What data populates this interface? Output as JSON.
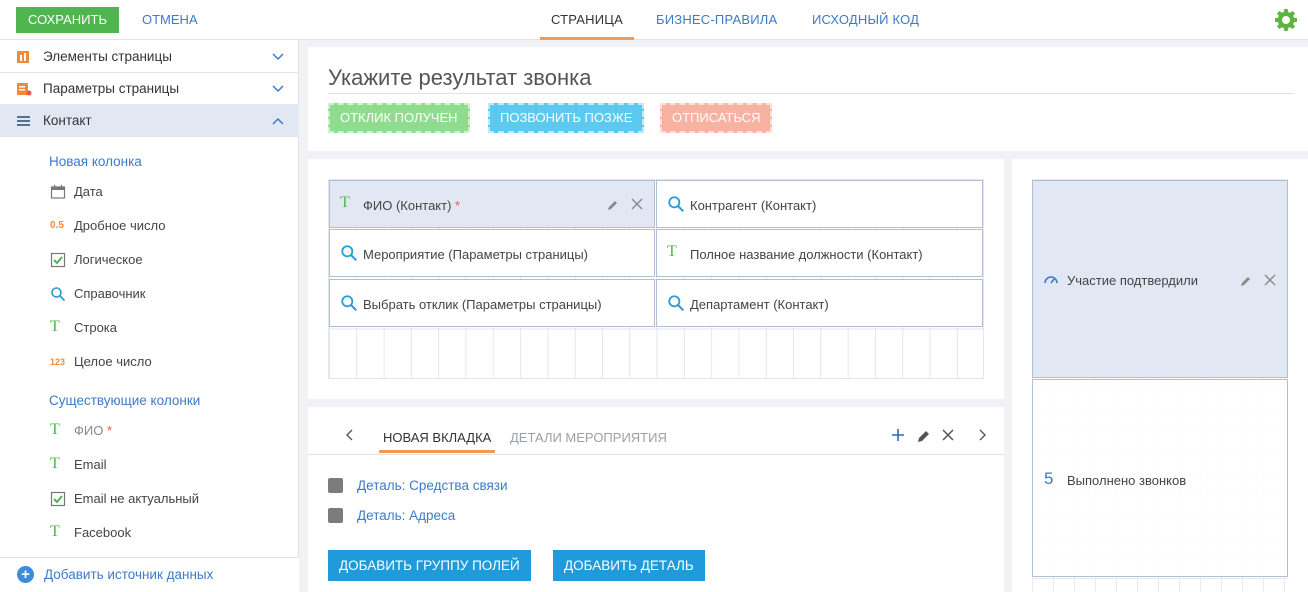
{
  "topbar": {
    "save_label": "СОХРАНИТЬ",
    "cancel_label": "ОТМЕНА",
    "tabs": [
      {
        "label": "СТРАНИЦА",
        "active": true
      },
      {
        "label": "БИЗНЕС-ПРАВИЛА",
        "active": false
      },
      {
        "label": "ИСХОДНЫЙ КОД",
        "active": false
      }
    ],
    "settings_icon": "gear-icon"
  },
  "sidebar": {
    "sections": [
      {
        "label": "Элементы страницы",
        "icon": "page-elements-icon",
        "open": false
      },
      {
        "label": "Параметры страницы",
        "icon": "page-params-icon",
        "open": false
      },
      {
        "label": "Контакт",
        "icon": "list-icon",
        "open": true
      }
    ],
    "new_columns_title": "Новая колонка",
    "new_columns": [
      {
        "label": "Дата",
        "icon": "calendar-icon"
      },
      {
        "label": "Дробное число",
        "icon": "decimal-icon",
        "glyph": "0.5"
      },
      {
        "label": "Логическое",
        "icon": "checkbox-icon"
      },
      {
        "label": "Справочник",
        "icon": "lookup-icon"
      },
      {
        "label": "Строка",
        "icon": "text-icon",
        "glyph": "T"
      },
      {
        "label": "Целое число",
        "icon": "integer-icon",
        "glyph": "123"
      }
    ],
    "existing_columns_title": "Существующие колонки",
    "existing_columns": [
      {
        "label": "ФИО",
        "icon": "text-icon",
        "glyph": "T",
        "required": "*"
      },
      {
        "label": "Email",
        "icon": "text-icon",
        "glyph": "T"
      },
      {
        "label": "Email не актуальный",
        "icon": "checkbox-icon"
      },
      {
        "label": "Facebook",
        "icon": "text-icon",
        "glyph": "T"
      }
    ],
    "add_source_label": "Добавить источник данных"
  },
  "header": {
    "title": "Укажите результат звонка",
    "buttons": [
      {
        "label": "ОТКЛИК ПОЛУЧЕН",
        "color": "#8fdc8f"
      },
      {
        "label": "ПОЗВОНИТЬ ПОЗЖЕ",
        "color": "#5cc9ef"
      },
      {
        "label": "ОТПИСАТЬСЯ",
        "color": "#f7b2a2"
      }
    ]
  },
  "fields": [
    {
      "label": "ФИО (Контакт)",
      "required": "*",
      "icon": "text-icon",
      "selected": true
    },
    {
      "label": "Контрагент (Контакт)",
      "icon": "lookup-icon",
      "selected": false
    },
    {
      "label": "Мероприятие (Параметры страницы)",
      "icon": "lookup-icon",
      "selected": false
    },
    {
      "label": "Полное название должности (Контакт)",
      "icon": "text-icon",
      "selected": false
    },
    {
      "label": "Выбрать отклик (Параметры страницы)",
      "icon": "lookup-icon",
      "selected": false
    },
    {
      "label": "Департамент (Контакт)",
      "icon": "lookup-icon",
      "selected": false
    }
  ],
  "tabs_panel": {
    "tabs": [
      {
        "label": "НОВАЯ ВКЛАДКА",
        "active": true
      },
      {
        "label": "ДЕТАЛИ МЕРОПРИЯТИЯ",
        "active": false
      }
    ],
    "details": [
      {
        "label": "Деталь: Средства связи"
      },
      {
        "label": "Деталь: Адреса"
      }
    ],
    "add_group_label": "ДОБАВИТЬ ГРУППУ ПОЛЕЙ",
    "add_detail_label": "ДОБАВИТЬ ДЕТАЛЬ"
  },
  "right_panel": {
    "cards": [
      {
        "label": "Участие подтвердили",
        "icon": "gauge-icon",
        "selected": true
      },
      {
        "label": "Выполнено звонков",
        "value": "5",
        "selected": false
      }
    ]
  },
  "colors": {
    "accent_blue": "#3c7bc6",
    "save_green": "#4fb54f",
    "tab_underline": "#f59a52",
    "selected_bg": "#e2e8f3",
    "action_button": "#1f9bdc"
  }
}
